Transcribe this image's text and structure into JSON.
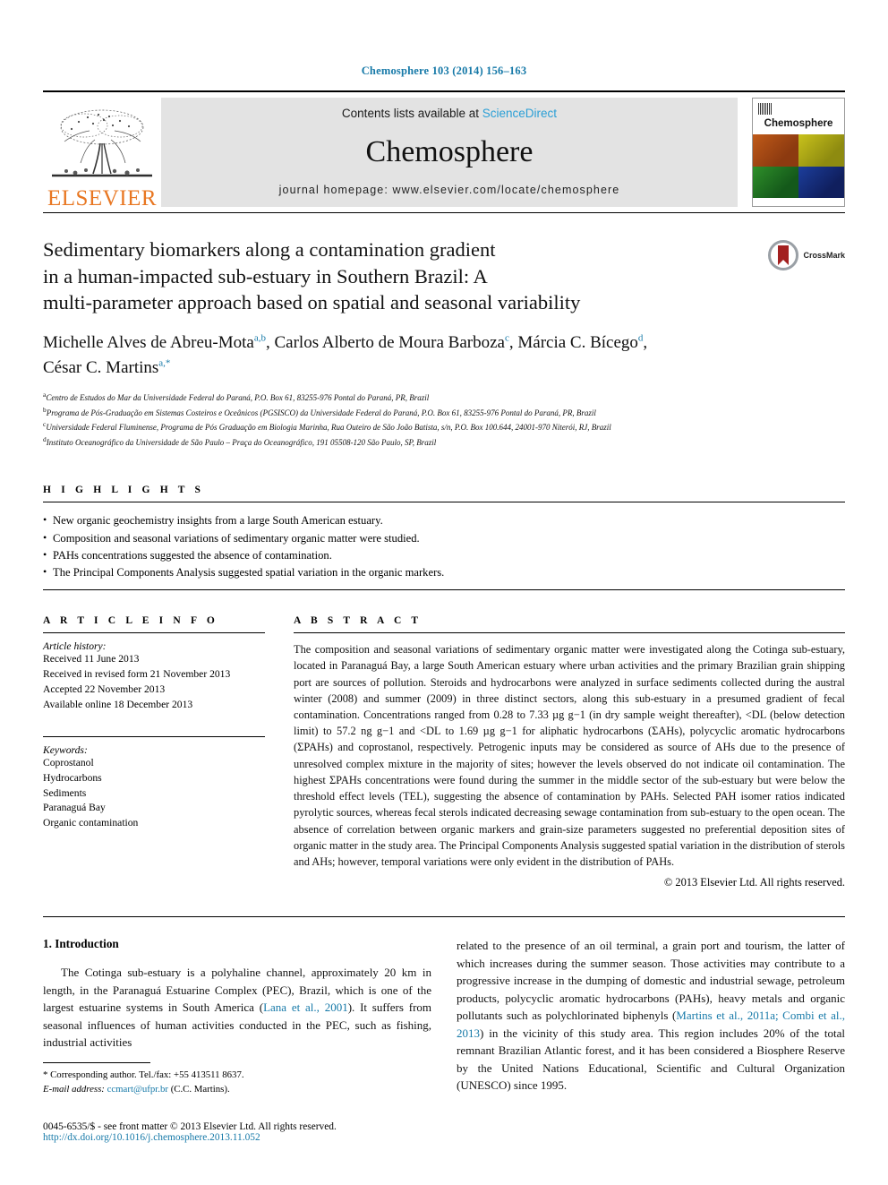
{
  "journal_ref": "Chemosphere 103 (2014) 156–163",
  "masthead": {
    "publisher": "ELSEVIER",
    "contents_text": "Contents lists available at",
    "sciencedirect": "ScienceDirect",
    "journal_title": "Chemosphere",
    "homepage": "journal homepage: www.elsevier.com/locate/chemosphere",
    "cover_name": "Chemosphere"
  },
  "article": {
    "title_line1": "Sedimentary biomarkers along a contamination gradient",
    "title_line2": "in a human-impacted sub-estuary in Southern Brazil: A",
    "title_line3": "multi-parameter approach based on spatial and seasonal variability",
    "crossmark_label": "CrossMark",
    "authors_line1_a": "Michelle Alves de Abreu-Mota",
    "authors_sup1": "a,b",
    "authors_line1_b": ", Carlos Alberto de Moura Barboza",
    "authors_sup2": "c",
    "authors_line1_c": ", Márcia C. Bícego",
    "authors_sup3": "d",
    "authors_line1_d": ",",
    "authors_line2_a": "César C. Martins",
    "authors_sup4": "a,*",
    "affiliations": [
      {
        "marker": "a",
        "text": "Centro de Estudos do Mar da Universidade Federal do Paraná, P.O. Box 61, 83255-976 Pontal do Paraná, PR, Brazil"
      },
      {
        "marker": "b",
        "text": "Programa de Pós-Graduação em Sistemas Costeiros e Oceânicos (PGSISCO) da Universidade Federal do Paraná, P.O. Box 61, 83255-976 Pontal do Paraná, PR, Brazil"
      },
      {
        "marker": "c",
        "text": "Universidade Federal Fluminense, Programa de Pós Graduação em Biologia Marinha, Rua Outeiro de São João Batista, s/n, P.O. Box 100.644, 24001-970 Niterói, RJ, Brazil"
      },
      {
        "marker": "d",
        "text": "Instituto Oceanográfico da Universidade de São Paulo – Praça do Oceanográfico, 191 05508-120 São Paulo, SP, Brazil"
      }
    ]
  },
  "highlights": {
    "heading": "H I G H L I G H T S",
    "items": [
      "New organic geochemistry insights from a large South American estuary.",
      "Composition and seasonal variations of sedimentary organic matter were studied.",
      "PAHs concentrations suggested the absence of contamination.",
      "The Principal Components Analysis suggested spatial variation in the organic markers."
    ]
  },
  "article_info": {
    "heading": "A R T I C L E    I N F O",
    "history_title": "Article history:",
    "history": [
      "Received 11 June 2013",
      "Received in revised form 21 November 2013",
      "Accepted 22 November 2013",
      "Available online 18 December 2013"
    ],
    "keywords_title": "Keywords:",
    "keywords": [
      "Coprostanol",
      "Hydrocarbons",
      "Sediments",
      "Paranaguá Bay",
      "Organic contamination"
    ]
  },
  "abstract": {
    "heading": "A B S T R A C T",
    "text": "The composition and seasonal variations of sedimentary organic matter were investigated along the Cotinga sub-estuary, located in Paranaguá Bay, a large South American estuary where urban activities and the primary Brazilian grain shipping port are sources of pollution. Steroids and hydrocarbons were analyzed in surface sediments collected during the austral winter (2008) and summer (2009) in three distinct sectors, along this sub-estuary in a presumed gradient of fecal contamination. Concentrations ranged from 0.28 to 7.33 µg g−1 (in dry sample weight thereafter), <DL (below detection limit) to 57.2 ng g−1 and <DL to 1.69 µg g−1 for aliphatic hydrocarbons (ΣAHs), polycyclic aromatic hydrocarbons (ΣPAHs) and coprostanol, respectively. Petrogenic inputs may be considered as source of AHs due to the presence of unresolved complex mixture in the majority of sites; however the levels observed do not indicate oil contamination. The highest ΣPAHs concentrations were found during the summer in the middle sector of the sub-estuary but were below the threshold effect levels (TEL), suggesting the absence of contamination by PAHs. Selected PAH isomer ratios indicated pyrolytic sources, whereas fecal sterols indicated decreasing sewage contamination from sub-estuary to the open ocean. The absence of correlation between organic markers and grain-size parameters suggested no preferential deposition sites of organic matter in the study area. The Principal Components Analysis suggested spatial variation in the distribution of sterols and AHs; however, temporal variations were only evident in the distribution of PAHs.",
    "copyright": "© 2013 Elsevier Ltd. All rights reserved."
  },
  "introduction": {
    "heading": "1. Introduction",
    "left_part1": "The Cotinga sub-estuary is a polyhaline channel, approximately 20 km in length, in the Paranaguá Estuarine Complex (PEC), Brazil, which is one of the largest estuarine systems in South America (",
    "left_ref1": "Lana et al., 2001",
    "left_part2": "). It suffers from seasonal influences of human activities conducted in the PEC, such as fishing, industrial activities",
    "right_part1": "related to the presence of an oil terminal, a grain port and tourism, the latter of which increases during the summer season. Those activities may contribute to a progressive increase in the dumping of domestic and industrial sewage, petroleum products, polycyclic aromatic hydrocarbons (PAHs), heavy metals and organic pollutants such as polychlorinated biphenyls (",
    "right_ref1": "Martins et al., 2011a; Combi et al., 2013",
    "right_part2": ") in the vicinity of this study area. This region includes 20% of the total remnant Brazilian Atlantic forest, and it has been considered a Biosphere Reserve by the United Nations Educational, Scientific and Cultural Organization (UNESCO) since 1995."
  },
  "footnote": {
    "corresponding": "* Corresponding author. Tel./fax: +55 413511 8637.",
    "email_label": "E-mail address:",
    "email": "ccmart@ufpr.br",
    "email_suffix": "(C.C. Martins)."
  },
  "footer": {
    "issn_line": "0045-6535/$ - see front matter © 2013 Elsevier Ltd. All rights reserved.",
    "doi": "http://dx.doi.org/10.1016/j.chemosphere.2013.11.052"
  },
  "colors": {
    "link": "#1679a8",
    "elsevier_orange": "#e87722",
    "sciencedirect": "#2a9fd6"
  }
}
